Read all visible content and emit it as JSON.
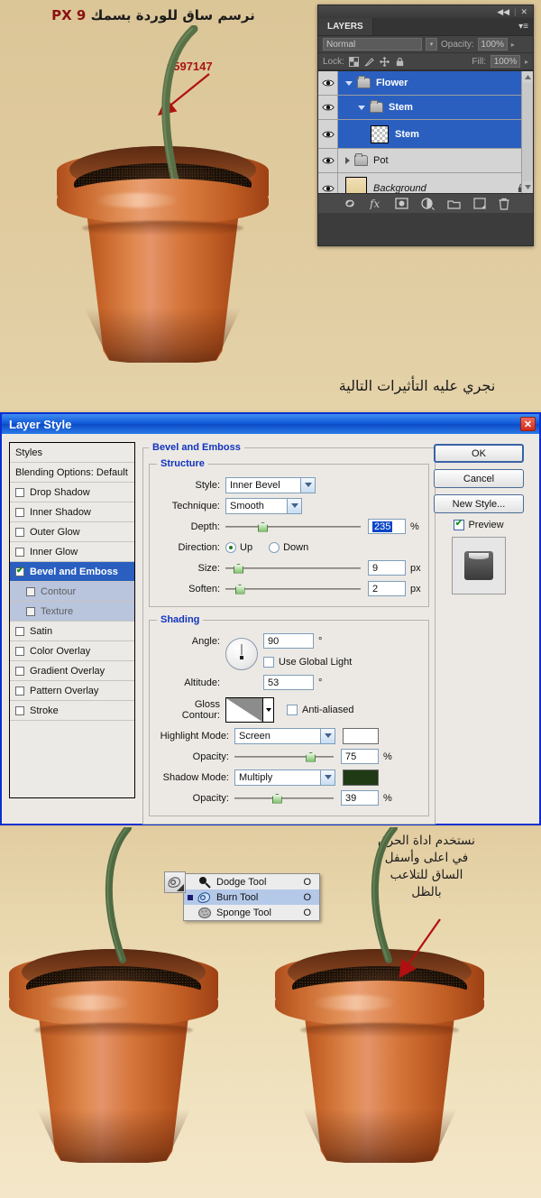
{
  "top": {
    "heading_ar": "نرسم ساق للوردة بسمك",
    "heading_px": "PX 9",
    "hex_label": "#597147",
    "stem_color": "#597147",
    "caption_ar": "نجري عليه التأثيرات التالية",
    "bg_color": "#dec99d"
  },
  "layers_panel": {
    "collapse_icon": "◀◀",
    "close_icon": "✕",
    "tab_label": "LAYERS",
    "menu_icon": "panel-menu-icon",
    "blend_mode": "Normal",
    "opacity_label": "Opacity:",
    "opacity_value": "100%",
    "lock_label": "Lock:",
    "fill_label": "Fill:",
    "fill_value": "100%",
    "lock_icons": [
      "transparency-lock-icon",
      "brush-lock-icon",
      "move-lock-icon",
      "all-lock-icon"
    ],
    "rows": [
      {
        "name": "Flower",
        "type": "group",
        "selected": true,
        "indent": 0,
        "disclosure": "open",
        "locked": false
      },
      {
        "name": "Stem",
        "type": "group",
        "selected": true,
        "indent": 1,
        "disclosure": "open",
        "locked": false
      },
      {
        "name": "Stem",
        "type": "layer",
        "selected": true,
        "indent": 2,
        "disclosure": "none",
        "locked": false
      },
      {
        "name": "Pot",
        "type": "group",
        "selected": false,
        "indent": 0,
        "disclosure": "closed",
        "locked": false
      },
      {
        "name": "Background",
        "type": "layer",
        "selected": false,
        "indent": 0,
        "disclosure": "none",
        "locked": true
      }
    ],
    "bottom_buttons": [
      "link-layers-icon",
      "fx-icon",
      "add-mask-icon",
      "adjustment-layer-icon",
      "new-group-icon",
      "new-layer-icon",
      "delete-layer-icon"
    ]
  },
  "layer_style": {
    "title": "Layer Style",
    "close_icon": "✕",
    "styles": [
      {
        "label": "Styles",
        "kind": "header"
      },
      {
        "label": "Blending Options: Default",
        "kind": "header"
      },
      {
        "label": "Drop Shadow",
        "kind": "check",
        "checked": false
      },
      {
        "label": "Inner Shadow",
        "kind": "check",
        "checked": false
      },
      {
        "label": "Outer Glow",
        "kind": "check",
        "checked": false
      },
      {
        "label": "Inner Glow",
        "kind": "check",
        "checked": false
      },
      {
        "label": "Bevel and Emboss",
        "kind": "check",
        "checked": true,
        "active": true
      },
      {
        "label": "Contour",
        "kind": "sub",
        "checked": false
      },
      {
        "label": "Texture",
        "kind": "sub",
        "checked": false
      },
      {
        "label": "Satin",
        "kind": "check",
        "checked": false
      },
      {
        "label": "Color Overlay",
        "kind": "check",
        "checked": false
      },
      {
        "label": "Gradient Overlay",
        "kind": "check",
        "checked": false
      },
      {
        "label": "Pattern Overlay",
        "kind": "check",
        "checked": false
      },
      {
        "label": "Stroke",
        "kind": "check",
        "checked": false
      }
    ],
    "section_title": "Bevel and Emboss",
    "structure": {
      "legend": "Structure",
      "style_label": "Style:",
      "style_value": "Inner Bevel",
      "technique_label": "Technique:",
      "technique_value": "Smooth",
      "depth_label": "Depth:",
      "depth_value": "235",
      "depth_unit": "%",
      "depth_pct": 24,
      "direction_label": "Direction:",
      "direction_up": "Up",
      "direction_down": "Down",
      "direction_selected": "Up",
      "size_label": "Size:",
      "size_value": "9",
      "size_unit": "px",
      "size_pct": 6,
      "soften_label": "Soften:",
      "soften_value": "2",
      "soften_unit": "px",
      "soften_pct": 7
    },
    "shading": {
      "legend": "Shading",
      "angle_label": "Angle:",
      "angle_value": "90",
      "angle_unit": "°",
      "global_light_label": "Use Global Light",
      "global_light_checked": false,
      "altitude_label": "Altitude:",
      "altitude_value": "53",
      "altitude_unit": "°",
      "gloss_label": "Gloss Contour:",
      "antialiased_label": "Anti-aliased",
      "antialiased_checked": false,
      "highlight_label": "Highlight Mode:",
      "highlight_value": "Screen",
      "highlight_color": "#ffffff",
      "highlight_opacity_label": "Opacity:",
      "highlight_opacity_value": "75",
      "highlight_opacity_unit": "%",
      "highlight_opacity_pct": 72,
      "shadow_label": "Shadow Mode:",
      "shadow_value": "Multiply",
      "shadow_color": "#1f3a14",
      "shadow_opacity_label": "Opacity:",
      "shadow_opacity_value": "39",
      "shadow_opacity_unit": "%",
      "shadow_opacity_pct": 38
    },
    "buttons": {
      "ok": "OK",
      "cancel": "Cancel",
      "new_style": "New Style...",
      "preview": "Preview",
      "preview_checked": true
    }
  },
  "bottom": {
    "caption_ar_lines": [
      "نستخدم اداة الحرق",
      "في اعلى وأسفل",
      "الساق للتلاعب",
      "بالظل"
    ],
    "tool_flyout": {
      "active_tool_icon": "burn-tool-icon",
      "items": [
        {
          "label": "Dodge Tool",
          "shortcut": "O",
          "icon": "dodge-tool-icon",
          "selected": false
        },
        {
          "label": "Burn Tool",
          "shortcut": "O",
          "icon": "burn-tool-icon",
          "selected": true
        },
        {
          "label": "Sponge Tool",
          "shortcut": "O",
          "icon": "sponge-tool-icon",
          "selected": false
        }
      ]
    }
  }
}
